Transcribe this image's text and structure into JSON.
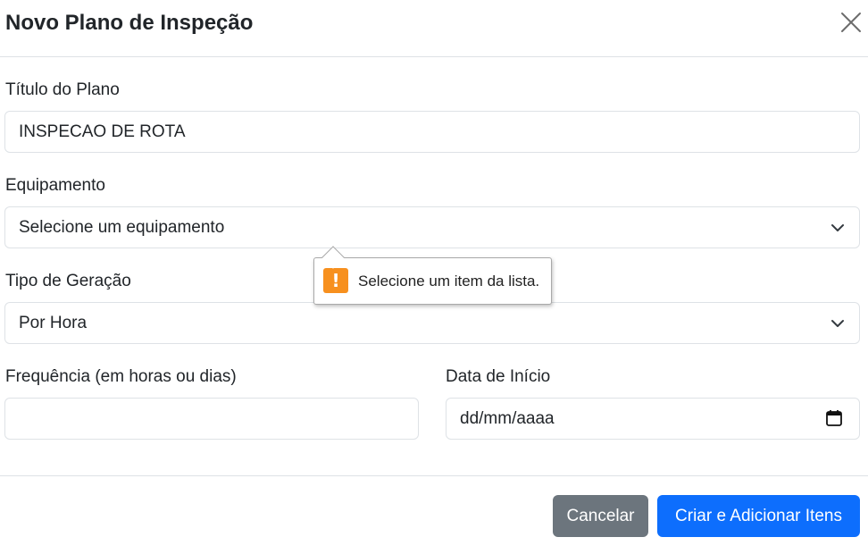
{
  "modal": {
    "title": "Novo Plano de Inspeção",
    "close_icon": "close-icon"
  },
  "form": {
    "title_label": "Título do Plano",
    "title_value": "INSPECAO DE ROTA",
    "equipment_label": "Equipamento",
    "equipment_selected": "Selecione um equipamento",
    "generation_label": "Tipo de Geração",
    "generation_selected": "Por Hora",
    "frequency_label": "Frequência (em horas ou dias)",
    "frequency_value": "",
    "start_date_label": "Data de Início",
    "start_date_placeholder": "dd/mm/aaaa"
  },
  "validation_tooltip": {
    "icon": "warning-icon",
    "message": "Selecione um item da lista."
  },
  "footer": {
    "cancel_label": "Cancelar",
    "submit_label": "Criar e Adicionar Itens"
  },
  "colors": {
    "primary": "#0d6efd",
    "secondary": "#6c757d",
    "warning_icon": "#f7901e",
    "border": "#dee2e6"
  }
}
